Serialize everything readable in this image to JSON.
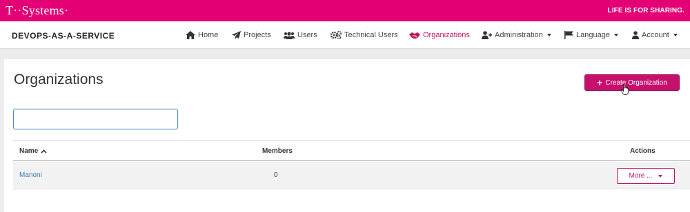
{
  "brand_bar": {
    "logo": "T··Systems·",
    "tagline": "LIFE IS FOR SHARING."
  },
  "navbar": {
    "brand": "DEVOPS-AS-A-SERVICE",
    "items": [
      {
        "label": "Home",
        "icon": "home-icon"
      },
      {
        "label": "Projects",
        "icon": "paper-plane-icon"
      },
      {
        "label": "Users",
        "icon": "users-icon"
      },
      {
        "label": "Technical Users",
        "icon": "gears-icon"
      },
      {
        "label": "Organizations",
        "icon": "handshake-icon",
        "active": true
      },
      {
        "label": "Administration",
        "icon": "user-plus-icon",
        "dropdown": true
      },
      {
        "label": "Language",
        "icon": "flag-icon",
        "dropdown": true
      },
      {
        "label": "Account",
        "icon": "user-icon",
        "dropdown": true
      }
    ]
  },
  "page": {
    "title": "Organizations",
    "create_button": "Create Organization",
    "search_value": "",
    "table": {
      "columns": [
        "Name",
        "Members",
        "Actions"
      ],
      "sort_column": "Name",
      "sort_direction": "ascending",
      "rows": [
        {
          "name": "Manoni",
          "members": "0",
          "action": "More ..."
        }
      ]
    }
  },
  "colors": {
    "brand_magenta": "#e20074",
    "button_magenta": "#c7106c",
    "link_blue": "#3a7ab8"
  }
}
